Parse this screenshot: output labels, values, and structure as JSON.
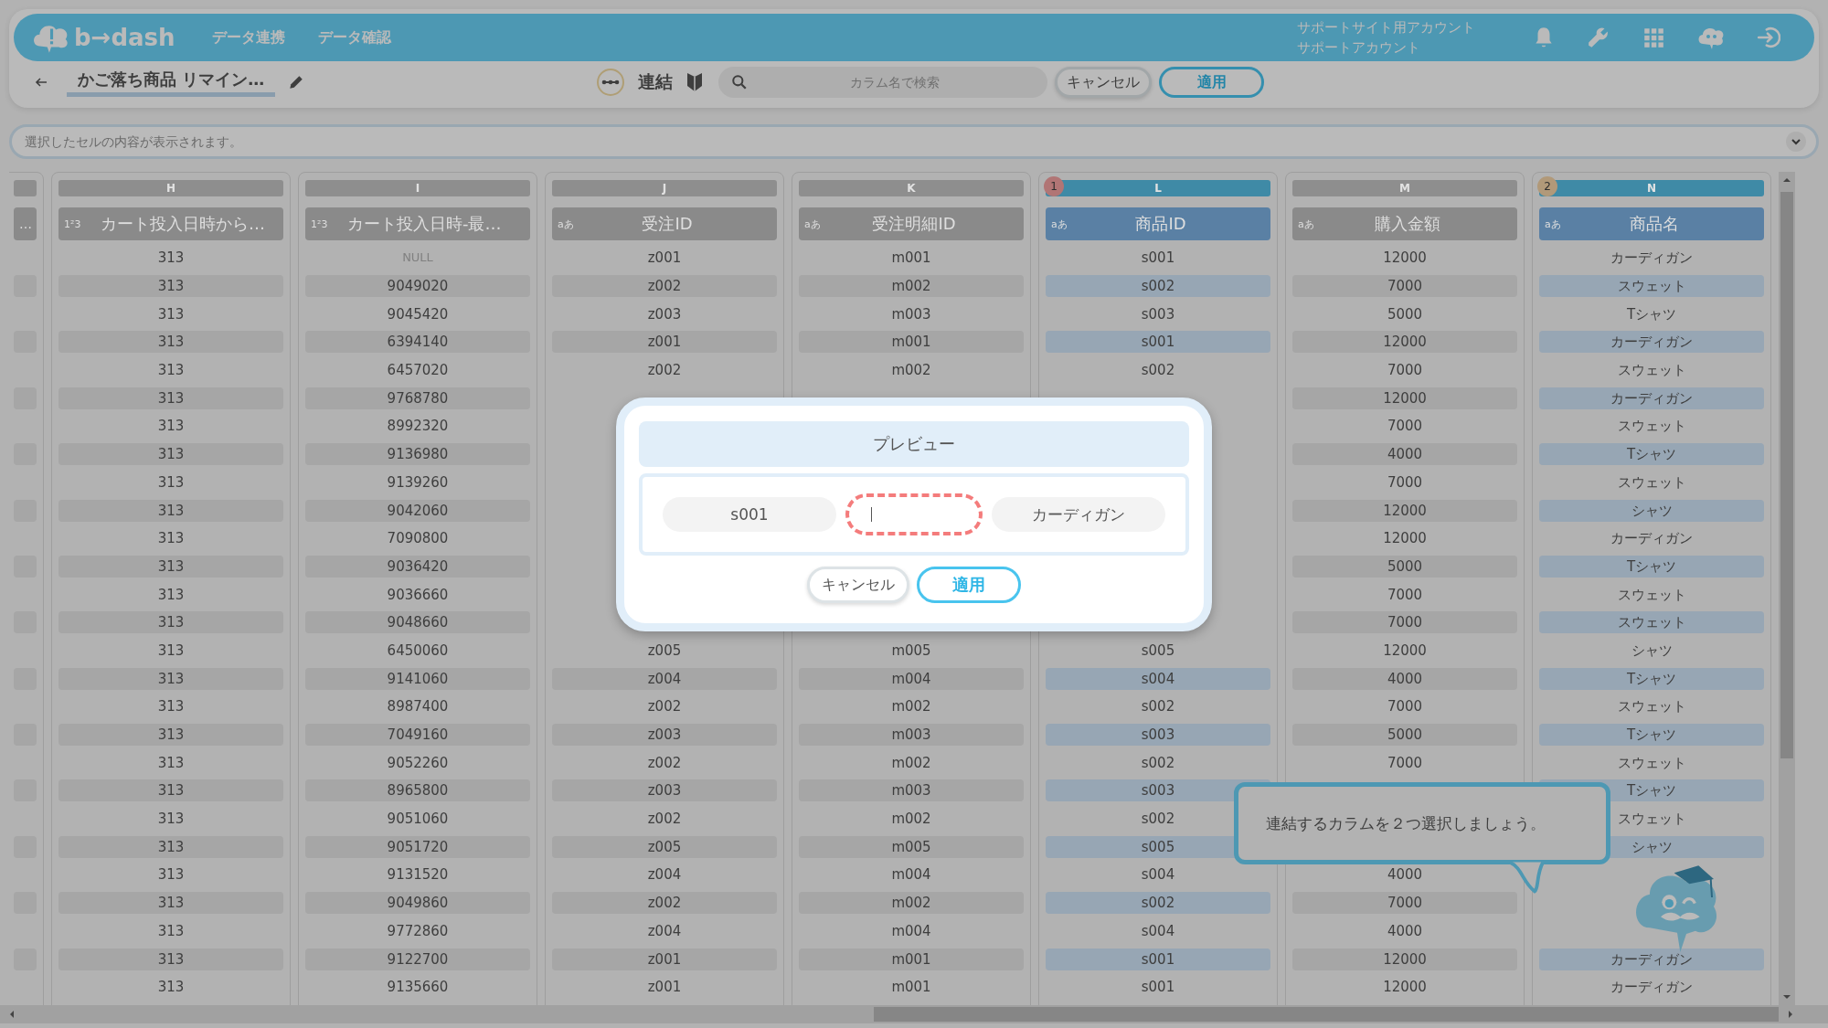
{
  "header": {
    "logo": "b→dash",
    "nav": [
      "データ連携",
      "データ確認"
    ],
    "account": [
      "サポートサイト用アカウント",
      "サポートアカウント"
    ]
  },
  "toolbar": {
    "title": "かご落ち商品 リマイン…",
    "mode": "連結",
    "search": {
      "placeholder": "カラム名で検索"
    },
    "buttons": [
      {
        "label": "キャンセル",
        "kind": "secondary"
      },
      {
        "label": "適用",
        "kind": "primary"
      }
    ]
  },
  "cell_viewer": {
    "placeholder": "選択したセルの内容が表示されます。"
  },
  "table": {
    "cut_column": {
      "name": "…"
    },
    "columns": [
      {
        "letter": "H",
        "type_badge": "1²3",
        "name": "カート投入日時から…",
        "selected": false,
        "cells": [
          "313",
          "313",
          "313",
          "313",
          "313",
          "313",
          "313",
          "313",
          "313",
          "313",
          "313",
          "313",
          "313",
          "313",
          "313",
          "313",
          "313",
          "313",
          "313",
          "313",
          "313",
          "313",
          "313",
          "313",
          "313",
          "313",
          "313"
        ]
      },
      {
        "letter": "I",
        "type_badge": "1²3",
        "name": "カート投入日時-最…",
        "selected": false,
        "cells": [
          "NULL",
          "9049020",
          "9045420",
          "6394140",
          "6457020",
          "9768780",
          "8992320",
          "9136980",
          "9139260",
          "9042060",
          "7090800",
          "9036420",
          "9036660",
          "9048660",
          "6450060",
          "9141060",
          "8987400",
          "7049160",
          "9052260",
          "8965800",
          "9051060",
          "9051720",
          "9131520",
          "9049860",
          "9772860",
          "9122700",
          "9135660"
        ]
      },
      {
        "letter": "J",
        "type_badge": "aあ",
        "name": "受注ID",
        "selected": false,
        "cells": [
          "z001",
          "z002",
          "z003",
          "z001",
          "z002",
          null,
          null,
          null,
          null,
          null,
          null,
          null,
          null,
          null,
          "z005",
          "z004",
          "z002",
          "z003",
          "z002",
          "z003",
          "z002",
          "z005",
          "z004",
          "z002",
          "z004",
          "z001",
          "z001"
        ]
      },
      {
        "letter": "K",
        "type_badge": "aあ",
        "name": "受注明細ID",
        "selected": false,
        "cells": [
          "m001",
          "m002",
          "m003",
          "m001",
          "m002",
          null,
          null,
          null,
          null,
          null,
          null,
          null,
          null,
          null,
          "m005",
          "m004",
          "m002",
          "m003",
          "m002",
          "m003",
          "m002",
          "m005",
          "m004",
          "m002",
          "m004",
          "m001",
          "m001"
        ]
      },
      {
        "letter": "L",
        "type_badge": "aあ",
        "name": "商品ID",
        "selected": true,
        "order": "1",
        "color": "#b17575",
        "cells": [
          "s001",
          "s002",
          "s003",
          "s001",
          "s002",
          null,
          null,
          null,
          null,
          null,
          null,
          null,
          null,
          null,
          "s005",
          "s004",
          "s002",
          "s003",
          "s002",
          "s003",
          "s002",
          "s005",
          "s004",
          "s002",
          "s004",
          "s001",
          "s001"
        ]
      },
      {
        "letter": "M",
        "type_badge": "aあ",
        "name": "購入金額",
        "selected": false,
        "cells": [
          "12000",
          "7000",
          "5000",
          "12000",
          "7000",
          "12000",
          "7000",
          "4000",
          "7000",
          "12000",
          "12000",
          "5000",
          "7000",
          "7000",
          "12000",
          "4000",
          "7000",
          "5000",
          "7000",
          null,
          null,
          null,
          "4000",
          "7000",
          "4000",
          "12000",
          "12000"
        ]
      },
      {
        "letter": "N",
        "type_badge": "aあ",
        "name": "商品名",
        "selected": true,
        "order": "2",
        "color": "#b19979",
        "cells": [
          "カーディガン",
          "スウェット",
          "Tシャツ",
          "カーディガン",
          "スウェット",
          "カーディガン",
          "スウェット",
          "Tシャツ",
          "スウェット",
          "シャツ",
          "カーディガン",
          "Tシャツ",
          "スウェット",
          "スウェット",
          "シャツ",
          "Tシャツ",
          "スウェット",
          "Tシャツ",
          "スウェット",
          "Tシャツ",
          "スウェット",
          "シャツ",
          null,
          null,
          null,
          "カーディガン",
          "カーディガン"
        ]
      }
    ]
  },
  "preview_dialog": {
    "title": "プレビュー",
    "left": "s001",
    "separator": {
      "focused": true
    },
    "right": "カーディガン",
    "buttons": [
      {
        "label": "キャンセル",
        "kind": "secondary"
      },
      {
        "label": "適用",
        "kind": "primary"
      }
    ]
  },
  "hint": {
    "text": "連結するカラムを２つ選択しましょう。"
  }
}
